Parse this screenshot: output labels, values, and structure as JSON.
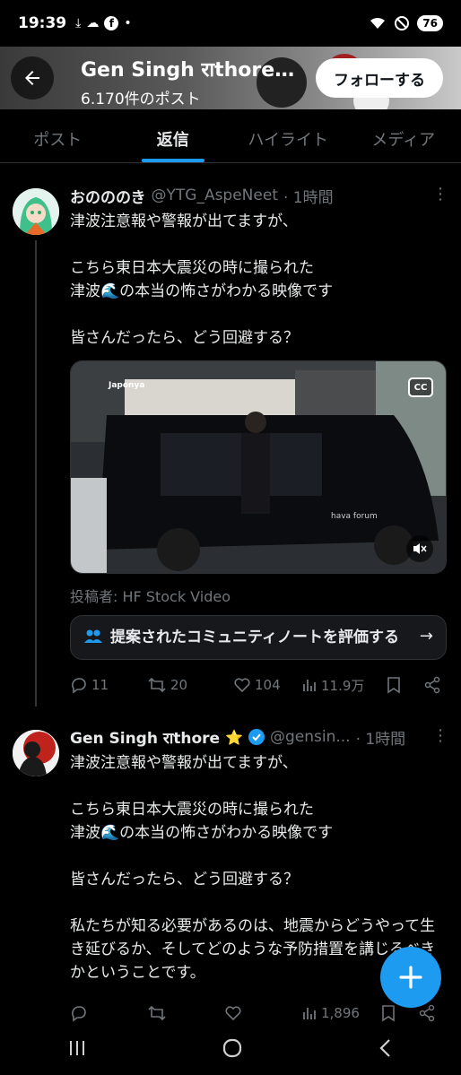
{
  "status_bar": {
    "time": "19:39",
    "battery": "76"
  },
  "header": {
    "title": "Gen Singh राthore...",
    "post_count": "6.170件のポスト",
    "follow_label": "フォローする"
  },
  "tabs": [
    {
      "label": "ポスト"
    },
    {
      "label": "返信"
    },
    {
      "label": "ハイライト"
    },
    {
      "label": "メディア"
    }
  ],
  "tweet1": {
    "name": "おのののき",
    "handle": "@YTG_AspeNeet",
    "time": "· 1時間",
    "text": "津波注意報や警報が出てますが、\n\nこちら東日本大震災の時に撮られた\n津波🌊の本当の怖さがわかる映像です\n\n皆さんだったら、どう回避する？",
    "media_watermark": "Japonya",
    "media_watermark2": "hava forum",
    "media_cc": "CC",
    "credit": "投稿者: HF Stock Video",
    "community_note": "提案されたコミュニティノートを評価する",
    "replies": "11",
    "retweets": "20",
    "likes": "104",
    "views": "11.9万"
  },
  "tweet2": {
    "name": "Gen Singh राthore",
    "star": "⭐",
    "handle": "@gensin...",
    "time": "· 1時間",
    "text": "津波注意報や警報が出てますが、\n\nこちら東日本大震災の時に撮られた\n津波🌊の本当の怖さがわかる映像です\n\n皆さんだったら、どう回避する？\n\n私たちが知る必要があるのは、地震からどうやって生き延びるか、そしてどのような予防措置を講じるべきかということです。",
    "views": "1,896"
  },
  "colors": {
    "accent": "#1d9bf0",
    "background": "#000000",
    "muted": "#71767b"
  }
}
